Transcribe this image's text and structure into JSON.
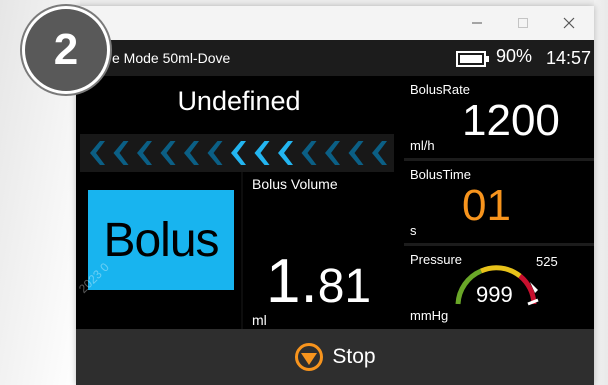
{
  "step_badge": "2",
  "window": {
    "minimize_icon": "minimize-icon",
    "maximize_icon": "maximize-icon",
    "close_icon": "close-icon"
  },
  "status": {
    "mode_text": "e Mode  50ml-Dove",
    "battery_icon": "battery-icon",
    "battery_pct": "90%",
    "time": "14:57"
  },
  "main": {
    "mode_title": "Undefined",
    "chevron_icon": "chevron-left-icon",
    "chevrons_total": 13,
    "chevrons_active": [
      6,
      7,
      8
    ],
    "colors": {
      "chevron_active": "#23b5f0",
      "chevron_inactive": "#0b5f85",
      "bolus_bg": "#18b4ef"
    },
    "bolus_label": "Bolus",
    "bolus_volume": {
      "title": "Bolus Volume",
      "int": "1.",
      "dec": "81",
      "unit": "ml"
    },
    "watermark": "2023  0"
  },
  "tiles": {
    "bolus_rate": {
      "title": "BolusRate",
      "value": "1200",
      "unit": "ml/h",
      "color": "#ffffff"
    },
    "bolus_time": {
      "title": "BolusTime",
      "value": "01",
      "unit": "s",
      "color": "#f7941d"
    },
    "pressure": {
      "title": "Pressure",
      "value": "999",
      "max": "525",
      "unit": "mmHg",
      "colors": {
        "low": "#6aa728",
        "mid": "#e8c21a",
        "high": "#c8102e"
      }
    }
  },
  "footer": {
    "stop_icon": "stop-icon",
    "stop_label": "Stop",
    "stop_color": "#f7941d"
  }
}
